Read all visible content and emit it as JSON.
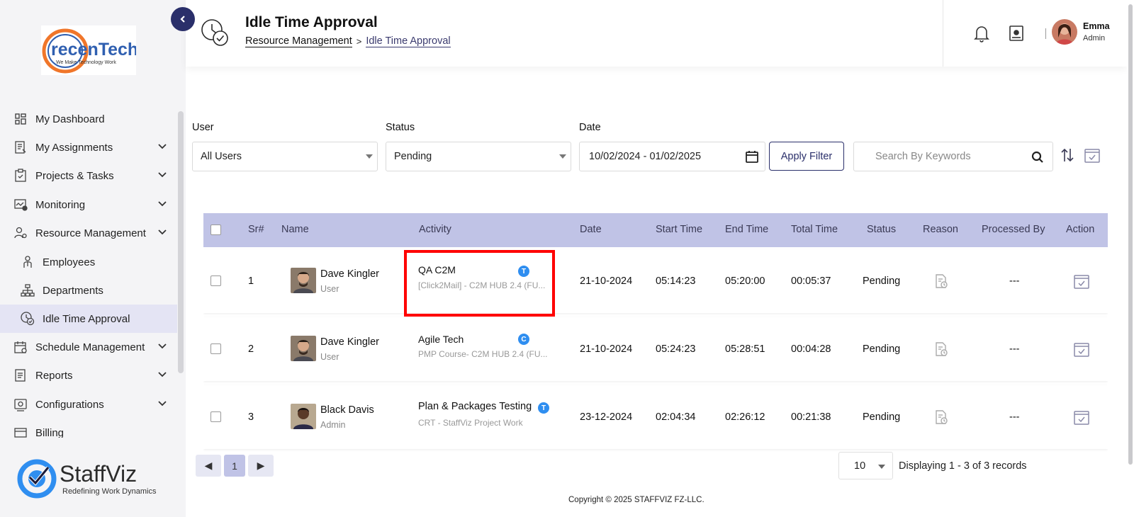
{
  "sidebar": {
    "logo": {
      "name": "recenTech",
      "tagline": "We Make Technology Work"
    },
    "items": [
      {
        "label": "My Dashboard",
        "icon": "dashboard-icon",
        "expandable": false
      },
      {
        "label": "My Assignments",
        "icon": "assignments-icon",
        "expandable": true
      },
      {
        "label": "Projects & Tasks",
        "icon": "clipboard-check-icon",
        "expandable": true
      },
      {
        "label": "Monitoring",
        "icon": "monitoring-icon",
        "expandable": true
      },
      {
        "label": "Resource Management",
        "icon": "user-gear-icon",
        "expandable": true
      },
      {
        "label": "Employees",
        "icon": "employee-icon",
        "sub": true
      },
      {
        "label": "Departments",
        "icon": "hierarchy-icon",
        "sub": true
      },
      {
        "label": "Idle Time Approval",
        "icon": "idle-clock-icon",
        "sub": true,
        "active": true
      },
      {
        "label": "Schedule Management",
        "icon": "calendar-icon",
        "expandable": true
      },
      {
        "label": "Reports",
        "icon": "report-icon",
        "expandable": true
      },
      {
        "label": "Configurations",
        "icon": "config-icon",
        "expandable": true
      },
      {
        "label": "Billing",
        "icon": "billing-icon",
        "expandable": true
      }
    ],
    "brand": {
      "name": "StaffViz",
      "tagline": "Redefining Work Dynamics"
    }
  },
  "header": {
    "title": "Idle Time Approval",
    "breadcrumb": [
      "Resource Management",
      "Idle Time Approval"
    ],
    "breadcrumb_separator": ">",
    "user": {
      "name": "Emma",
      "role": "Admin"
    }
  },
  "filters": {
    "user_label": "User",
    "user_value": "All Users",
    "status_label": "Status",
    "status_value": "Pending",
    "date_label": "Date",
    "date_value": "10/02/2024 - 01/02/2025",
    "apply_label": "Apply Filter",
    "search_placeholder": "Search By Keywords"
  },
  "table": {
    "columns": [
      "Sr#",
      "Name",
      "Activity",
      "Date",
      "Start Time",
      "End Time",
      "Total Time",
      "Status",
      "Reason",
      "Processed By",
      "Action"
    ],
    "rows": [
      {
        "sr": "1",
        "name": "Dave Kingler",
        "role": "User",
        "activity": "QA C2M",
        "activity_sub": "[Click2Mail] - C2M HUB 2.4 (FU...",
        "badge": "T",
        "date": "21-10-2024",
        "start": "05:14:23",
        "end": "05:20:00",
        "total": "00:05:37",
        "status": "Pending",
        "processed_by": "---"
      },
      {
        "sr": "2",
        "name": "Dave Kingler",
        "role": "User",
        "activity": "Agile Tech",
        "activity_sub": "PMP Course- C2M HUB 2.4 (FU...",
        "badge": "C",
        "date": "21-10-2024",
        "start": "05:24:23",
        "end": "05:28:51",
        "total": "00:04:28",
        "status": "Pending",
        "processed_by": "---"
      },
      {
        "sr": "3",
        "name": "Black Davis",
        "role": "Admin",
        "activity": "Plan & Packages Testing",
        "activity_sub": "CRT - StaffViz Project Work",
        "badge": "T",
        "date": "23-12-2024",
        "start": "02:04:34",
        "end": "02:26:12",
        "total": "00:21:38",
        "status": "Pending",
        "processed_by": "---"
      }
    ]
  },
  "pagination": {
    "prev": "◀",
    "current_page": "1",
    "next": "▶",
    "per_page": "10",
    "summary": "Displaying 1 - 3 of 3 records"
  },
  "footer": {
    "copyright": "Copyright © 2025 STAFFVIZ FZ-LLC."
  },
  "colors": {
    "accent": "#2a2f6a",
    "table_header": "#c0c3e6",
    "badge": "#2f8ef0",
    "highlight": "#ff0000",
    "active_nav": "#e4e4f4"
  }
}
